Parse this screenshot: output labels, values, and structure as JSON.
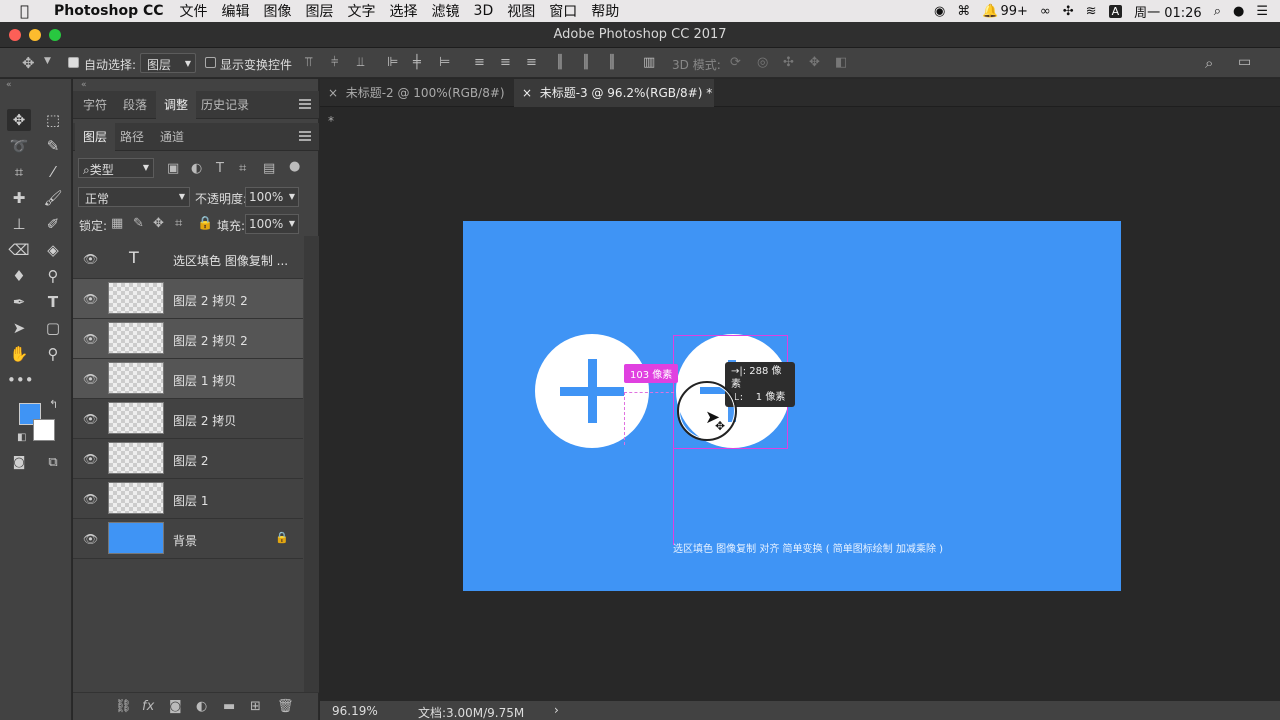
{
  "menubar": {
    "app_name": "Photoshop CC",
    "items": [
      "文件",
      "编辑",
      "图像",
      "图层",
      "文字",
      "选择",
      "滤镜",
      "3D",
      "视图",
      "窗口",
      "帮助"
    ],
    "notif_count": "99+",
    "input_method": "A",
    "clock": "周一 01:26"
  },
  "window": {
    "title": "Adobe Photoshop CC 2017"
  },
  "options": {
    "auto_select_label": "自动选择:",
    "auto_select_value": "图层",
    "show_transform_label": "显示变换控件",
    "mode_3d_label": "3D 模式:"
  },
  "panel_top": {
    "tabs": [
      "字符",
      "段落",
      "调整",
      "历史记录"
    ],
    "active": "调整"
  },
  "layers_panel": {
    "tabs": [
      "图层",
      "路径",
      "通道"
    ],
    "filter_label": "类型",
    "blend_mode": "正常",
    "opacity_label": "不透明度:",
    "opacity_value": "100%",
    "lock_label": "锁定:",
    "fill_label": "填充:",
    "fill_value": "100%",
    "layers": [
      {
        "name": "选区填色  图像复制  ...",
        "type": "text"
      },
      {
        "name": "图层 2 拷贝 2",
        "type": "pixel"
      },
      {
        "name": "图层 2 拷贝 2",
        "type": "pixel"
      },
      {
        "name": "图层 1 拷贝",
        "type": "pixel"
      },
      {
        "name": "图层 2 拷贝",
        "type": "pixel"
      },
      {
        "name": "图层 2",
        "type": "pixel"
      },
      {
        "name": "图层 1",
        "type": "pixel"
      },
      {
        "name": "背景",
        "type": "background"
      }
    ]
  },
  "doc_tabs": [
    {
      "label": "未标题-2 @ 100%(RGB/8#) *"
    },
    {
      "label": "未标题-3 @ 96.2%(RGB/8#) *"
    }
  ],
  "canvas": {
    "background_color": "#3f94f5",
    "caption": "选区填色  图像复制  对齐  简单变换 ( 简单图标绘制  加减乘除 )",
    "distance_badge": "103 像素",
    "tooltip_line1": "→|: 288 像素",
    "tooltip_line2": "⊥:    1 像素"
  },
  "status": {
    "zoom": "96.19%",
    "doc_info": "文档:3.00M/9.75M"
  },
  "colors": {
    "foreground": "#3f94f5",
    "background": "#ffffff",
    "accent": "#e040e0"
  }
}
